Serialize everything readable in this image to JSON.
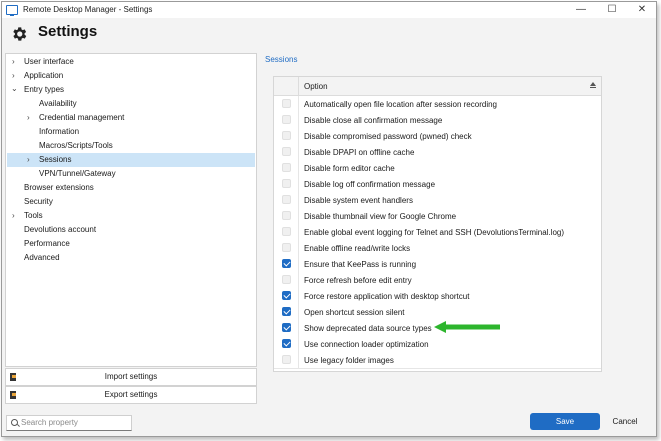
{
  "window": {
    "title": "Remote Desktop Manager - Settings",
    "minimize_glyph": "—",
    "maximize_glyph": "☐",
    "close_glyph": "✕"
  },
  "header": {
    "title": "Settings",
    "icon": "gear-icon"
  },
  "sidebar": {
    "items": [
      {
        "label": "User interface",
        "expandable": true,
        "selected": false
      },
      {
        "label": "Application",
        "expandable": true,
        "selected": false
      },
      {
        "label": "Entry types",
        "expandable": true,
        "expanded": true,
        "selected": false
      },
      {
        "label": "Availability",
        "expandable": false,
        "selected": false
      },
      {
        "label": "Credential management",
        "expandable": true,
        "selected": false
      },
      {
        "label": "Information",
        "expandable": false,
        "selected": false
      },
      {
        "label": "Macros/Scripts/Tools",
        "expandable": false,
        "selected": false
      },
      {
        "label": "Sessions",
        "expandable": true,
        "selected": true
      },
      {
        "label": "VPN/Tunnel/Gateway",
        "expandable": false,
        "selected": false
      },
      {
        "label": "Browser extensions",
        "expandable": false,
        "selected": false
      },
      {
        "label": "Security",
        "expandable": false,
        "selected": false
      },
      {
        "label": "Tools",
        "expandable": true,
        "selected": false
      },
      {
        "label": "Devolutions account",
        "expandable": false,
        "selected": false
      },
      {
        "label": "Performance",
        "expandable": false,
        "selected": false
      },
      {
        "label": "Advanced",
        "expandable": false,
        "selected": false
      }
    ],
    "import_label": "Import settings",
    "export_label": "Export settings"
  },
  "main": {
    "section_title": "Sessions",
    "column_header": "Option",
    "options": [
      {
        "label": "Automatically open file location after session recording",
        "checked": false
      },
      {
        "label": "Disable close all confirmation message",
        "checked": false
      },
      {
        "label": "Disable compromised password (pwned) check",
        "checked": false
      },
      {
        "label": "Disable DPAPI on offline cache",
        "checked": false
      },
      {
        "label": "Disable form editor cache",
        "checked": false
      },
      {
        "label": "Disable log off confirmation message",
        "checked": false
      },
      {
        "label": "Disable system event handlers",
        "checked": false
      },
      {
        "label": "Disable thumbnail view for Google Chrome",
        "checked": false
      },
      {
        "label": "Enable global event logging for Telnet and SSH (DevolutionsTerminal.log)",
        "checked": false
      },
      {
        "label": "Enable offline read/write locks",
        "checked": false
      },
      {
        "label": "Ensure that KeePass is running",
        "checked": true
      },
      {
        "label": "Force refresh before edit entry",
        "checked": false
      },
      {
        "label": "Force restore application with desktop shortcut",
        "checked": true
      },
      {
        "label": "Open shortcut session silent",
        "checked": true
      },
      {
        "label": "Show deprecated data source types",
        "checked": true
      },
      {
        "label": "Use connection loader optimization",
        "checked": true
      },
      {
        "label": "Use legacy folder images",
        "checked": false
      }
    ]
  },
  "footer": {
    "search_placeholder": "Search property",
    "save_label": "Save",
    "cancel_label": "Cancel"
  },
  "colors": {
    "accent": "#1f6cc4",
    "selection": "#cce4f7",
    "annotation_arrow": "#2db52d"
  }
}
